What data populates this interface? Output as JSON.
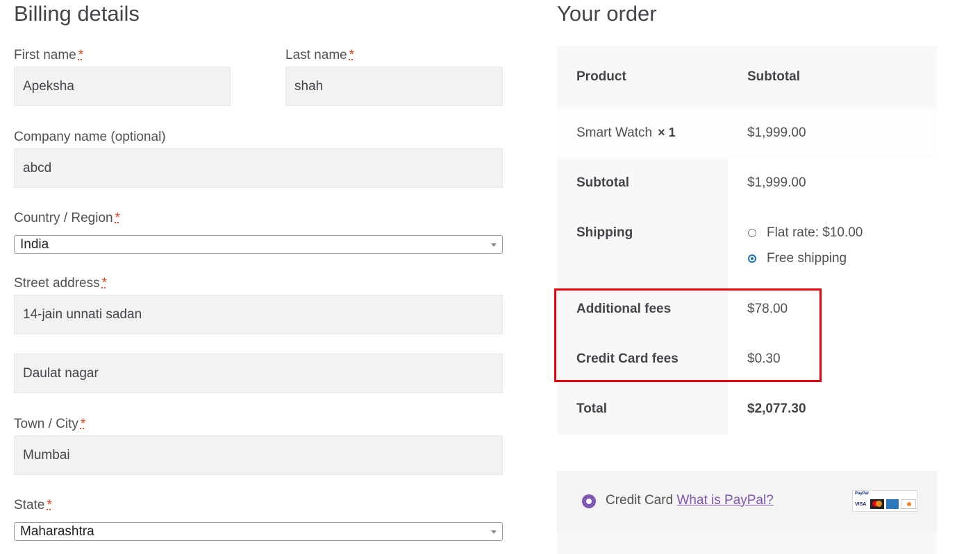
{
  "billing": {
    "title": "Billing details",
    "required_mark": "*",
    "first_name": {
      "label": "First name",
      "value": "Apeksha"
    },
    "last_name": {
      "label": "Last name",
      "value": "shah"
    },
    "company": {
      "label": "Company name (optional)",
      "value": "abcd"
    },
    "country": {
      "label": "Country / Region",
      "value": "India"
    },
    "street": {
      "label": "Street address",
      "value": "14-jain unnati sadan",
      "value2": "Daulat nagar"
    },
    "city": {
      "label": "Town / City",
      "value": "Mumbai"
    },
    "state": {
      "label": "State",
      "value": "Maharashtra"
    }
  },
  "order": {
    "title": "Your order",
    "col_product": "Product",
    "col_subtotal": "Subtotal",
    "item": {
      "name": "Smart Watch",
      "qty": "× 1",
      "price": "$1,999.00"
    },
    "subtotal_label": "Subtotal",
    "subtotal_value": "$1,999.00",
    "shipping_label": "Shipping",
    "shipping_options": [
      {
        "label": "Flat rate: $10.00",
        "selected": false
      },
      {
        "label": "Free shipping",
        "selected": true
      }
    ],
    "additional_fees_label": "Additional fees",
    "additional_fees_value": "$78.00",
    "cc_fees_label": "Credit Card fees",
    "cc_fees_value": "$0.30",
    "total_label": "Total",
    "total_value": "$2,077.30"
  },
  "payment": {
    "method_label": "Credit Card",
    "link_text": "What is PayPal?",
    "card_logos": [
      "PayPal",
      "VISA",
      "Mastercard",
      "AMEX",
      "DISCOVER"
    ]
  },
  "colors": {
    "accent": "#7f54b3",
    "highlight": "#e8000b",
    "required": "#e2401c",
    "table_header_bg": "#f8f8f8",
    "table_body_bg": "#fdfdfd"
  }
}
